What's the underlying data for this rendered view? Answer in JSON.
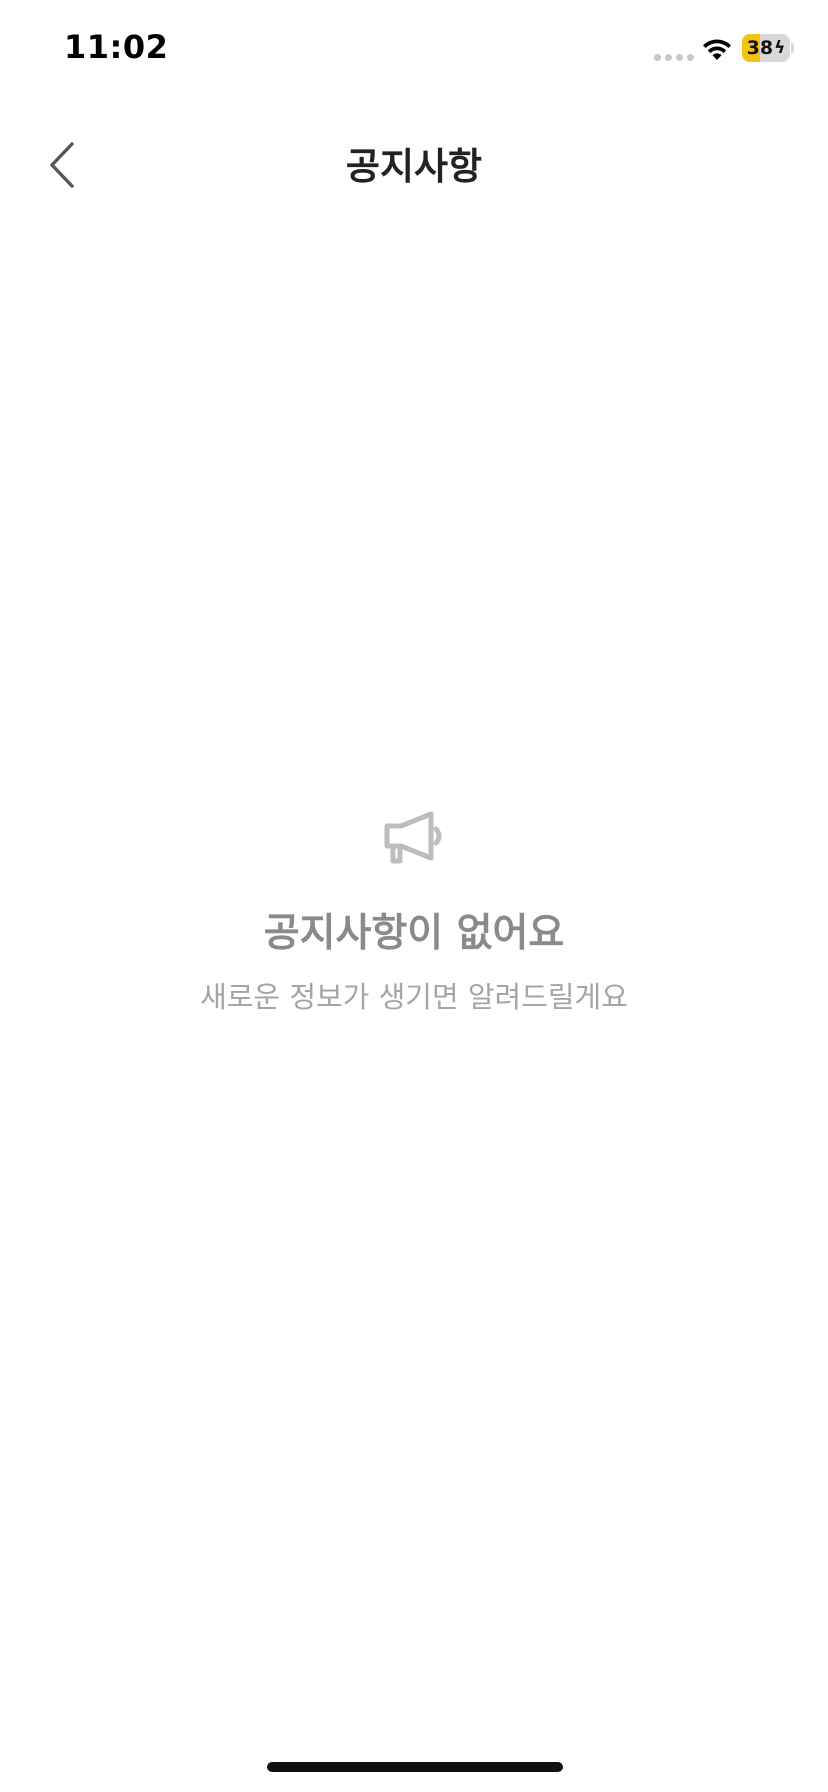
{
  "status_bar": {
    "time": "11:02",
    "battery_percent": "38",
    "battery_level": 0.38,
    "battery_charging": true,
    "battery_color": "#f4c40f"
  },
  "nav": {
    "title": "공지사항",
    "back_icon": "chevron-left-icon"
  },
  "empty_state": {
    "icon": "megaphone-icon",
    "title": "공지사항이 없어요",
    "subtitle": "새로운 정보가 생기면 알려드릴게요"
  }
}
